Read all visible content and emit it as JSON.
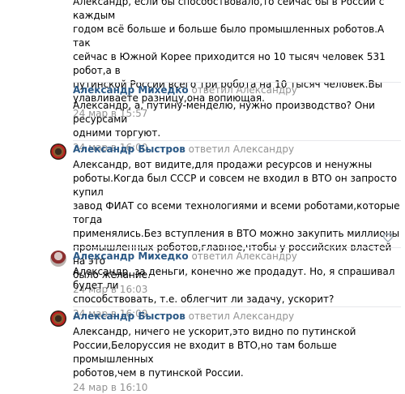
{
  "comments": [
    {
      "author": "",
      "text_lines": [
        "Александр, если бы способствовало,то сейчас бы в России с каждым",
        "годом всё больше и больше было промышленных роботов.А так",
        "сейчас в Южной Корее приходится но 10 тысяч человек 531 робот,а в",
        "путинской России всего три робота на 10 тысяч человек.Вы",
        "улавливаете разницу,она вопиющая."
      ],
      "date": "24 мар в 15:57"
    },
    {
      "author": "Александр Михедко",
      "replied": "ответил Александру",
      "text_lines": [
        "Александр, а, путину-менделю, нужно производство? Они ресурсами",
        "одними торгуют."
      ],
      "date": "24 мар в 16:00"
    },
    {
      "author": "Александр Быстров",
      "replied": "ответил Александру",
      "text_lines": [
        "Александр, вот видите,для продажи ресурсов и ненужны",
        "роботы.Когда был СССР и совсем не входил в ВТО он запросто купил",
        "завод ФИАТ со всеми технологиями и всеми роботами,которые тогда",
        "применялись.Без вступления в ВТО можно закупить миллионы",
        "промышленных роботов,главное,чтобы у российских властей на это",
        "было желание."
      ],
      "date": "24 мар в 16:03"
    },
    {
      "author": "Александр Михедко",
      "replied": "ответил Александру",
      "text_lines": [
        "Александр, за деньги, конечно же продадут. Но, я спрашивал будет ли",
        "способствовать, т.е. облегчит ли задачу, ускорит?"
      ],
      "date": "24 мар в 16:09"
    },
    {
      "author": "Александр Быстров",
      "replied": "ответил Александру",
      "text_lines": [
        "Александр, ничего не ускорит,это видно по путинской",
        "России,Белоруссия не входит в ВТО,но там больше промышленных",
        "роботов,чем в путинской России."
      ],
      "date": "24 мар в 16:10"
    }
  ],
  "icons": {
    "like": "heart-icon"
  },
  "colors": {
    "author": "#2a5885",
    "meta": "#939393",
    "separator": "#e7e8ec"
  }
}
